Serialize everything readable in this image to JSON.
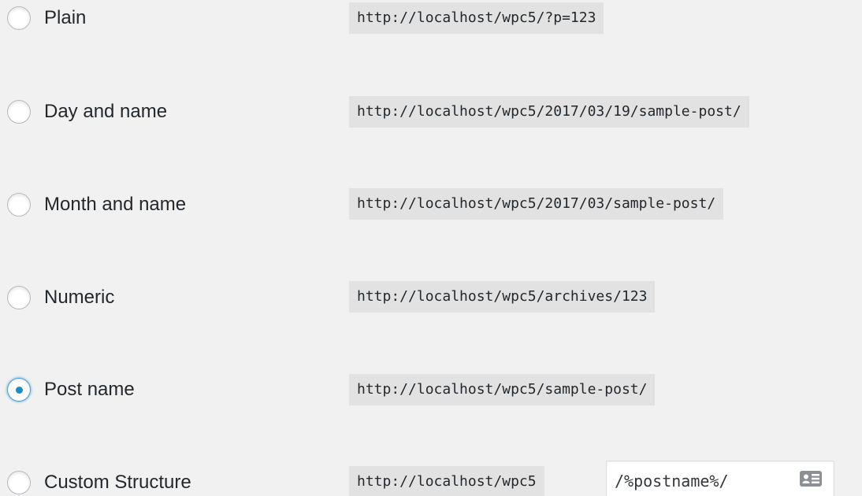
{
  "permalink_options": [
    {
      "label": "Plain",
      "example": "http://localhost/wpc5/?p=123",
      "checked": false
    },
    {
      "label": "Day and name",
      "example": "http://localhost/wpc5/2017/03/19/sample-post/",
      "checked": false
    },
    {
      "label": "Month and name",
      "example": "http://localhost/wpc5/2017/03/sample-post/",
      "checked": false
    },
    {
      "label": "Numeric",
      "example": "http://localhost/wpc5/archives/123",
      "checked": false
    },
    {
      "label": "Post name",
      "example": "http://localhost/wpc5/sample-post/",
      "checked": true
    },
    {
      "label": "Custom Structure",
      "example": "http://localhost/wpc5",
      "checked": false
    }
  ],
  "custom_structure": {
    "value": "/%postname%/",
    "icon": "contact-card-icon"
  },
  "colors": {
    "background": "#f1f1f1",
    "code_background": "#e2e2e2",
    "radio_checked": "#1e8cbe",
    "text": "#23282d"
  }
}
